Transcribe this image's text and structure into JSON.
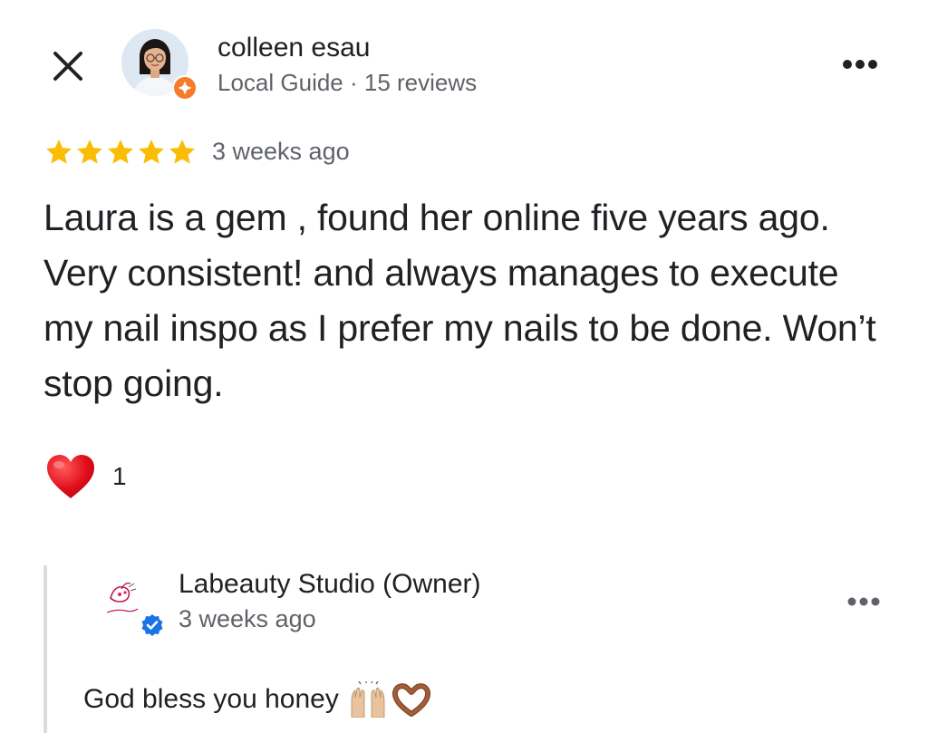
{
  "header": {
    "close_icon": "close-icon",
    "more_icon": "more-horizontal-icon"
  },
  "reviewer": {
    "name": "colleen esau",
    "meta": "Local Guide · 15 reviews",
    "avatar_icon": "user-avatar",
    "badge_icon": "local-guide-badge-icon"
  },
  "review": {
    "rating": 5,
    "rating_max": 5,
    "star_color": "#FBBC04",
    "time": "3 weeks ago",
    "text": "Laura is a gem , found her online five years ago. Very consistent! and always manages to execute my nail inspo as I prefer my nails to be done. Won’t stop going."
  },
  "reaction": {
    "icon": "heart-icon",
    "count": "1"
  },
  "owner_reply": {
    "name": "Labeauty Studio (Owner)",
    "time": "3 weeks ago",
    "text": "God bless you honey",
    "emoji": [
      "raising-hands-icon",
      "heart-hands-icon"
    ],
    "avatar_icon": "business-logo",
    "badge_icon": "verified-icon",
    "more_icon": "more-horizontal-icon"
  },
  "colors": {
    "text_primary": "#202124",
    "text_secondary": "#5f6368",
    "star": "#FBBC04",
    "guide_badge": "#F57C2B",
    "verified": "#1A73E8",
    "reply_border": "#dadce0"
  }
}
